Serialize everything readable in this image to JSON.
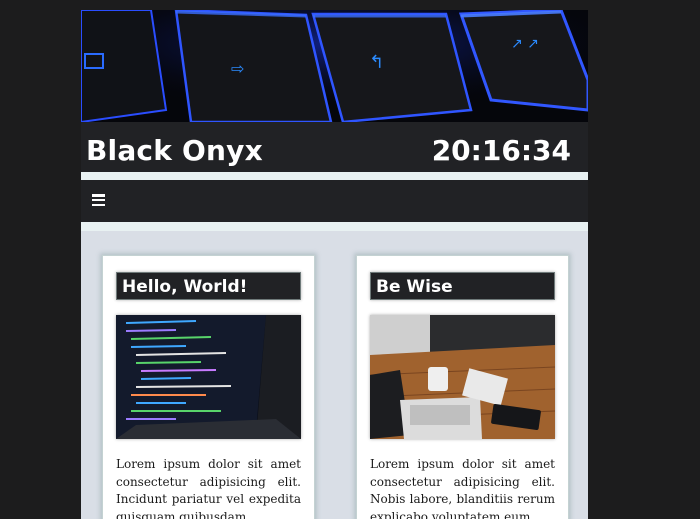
{
  "header": {
    "site_title": "Black Onyx",
    "clock": "20:16:34",
    "banner_image": "keyboard-keys-blue-backlight"
  },
  "nav": {
    "menu_icon": "hamburger-menu-icon"
  },
  "cards": [
    {
      "title": "Hello, World!",
      "image": "laptop-code-screen",
      "text": "Lorem ipsum dolor sit amet consectetur adipisicing elit. Incidunt pariatur vel expedita quisquam quibusdam"
    },
    {
      "title": "Be Wise",
      "image": "laptop-on-wooden-desk",
      "text": "Lorem ipsum dolor sit amet consectetur adipisicing elit. Nobis labore, blanditiis rerum explicabo voluptatem eum"
    }
  ],
  "colors": {
    "background": "#1c1c1d",
    "panel": "#212225",
    "page": "#d9dee6",
    "accent_blue": "#1e6bff"
  }
}
